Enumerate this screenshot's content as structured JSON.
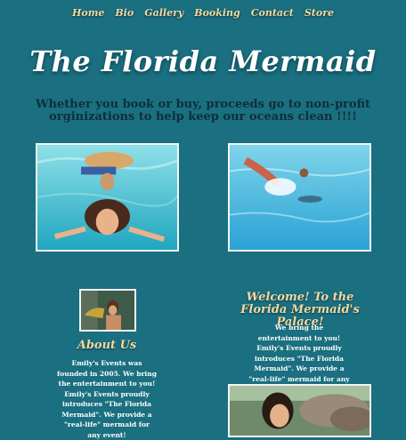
{
  "nav": {
    "items": [
      "Home",
      "Bio",
      "Gallery",
      "Booking",
      "Contact",
      "Store"
    ]
  },
  "header": {
    "title": "The Florida Mermaid"
  },
  "tagline": "Whether you book or buy, proceeds go to non-profit orginizations to help keep our oceans clean !!!!",
  "about": {
    "title": "About Us",
    "text": "Emily's Events was founded in 2005. We bring the entertainment to you! Emily's Events proudly introduces \"The Florida Mermaid\". We provide a \"real-life\" mermaid for any event!"
  },
  "welcome": {
    "title": "Welcome! To the Florida Mermaid's Palace!",
    "text": "We bring the entertainment to you! Emily's Events proudly introduces \"The Florida Mermaid\". We provide a \"real-life\" mermaid for any event!"
  },
  "colors": {
    "background": "#1a6f80",
    "accent": "#f3d9a0",
    "tagline": "#0e2f3a"
  }
}
